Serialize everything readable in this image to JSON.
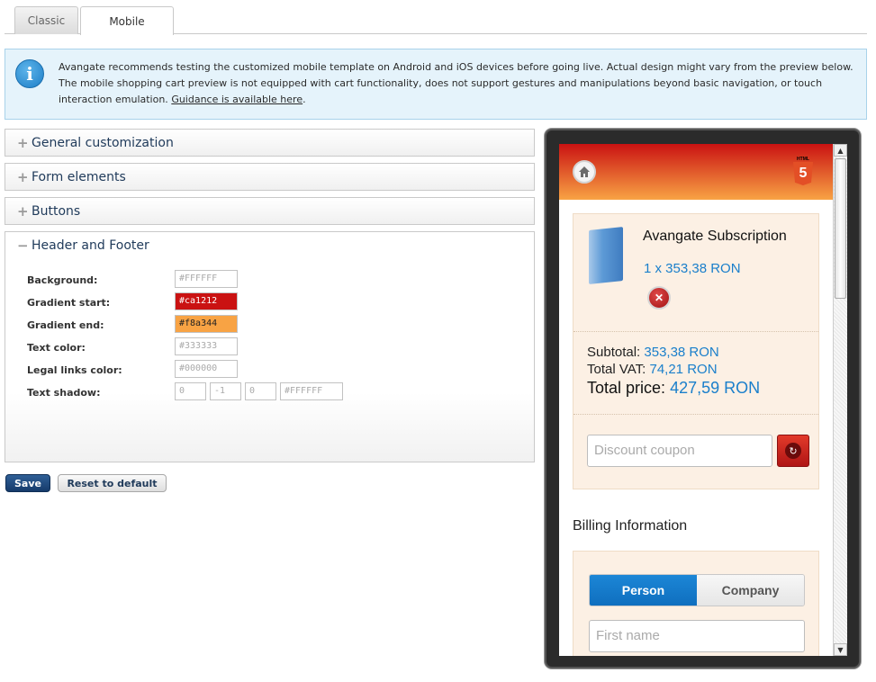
{
  "tabs": [
    {
      "label": "Classic"
    },
    {
      "label": "Mobile"
    }
  ],
  "info": {
    "icon": "info-icon",
    "text": "Avangate recommends testing the customized mobile template on Android and iOS devices before going live. Actual design might vary from the preview below. The mobile shopping cart preview is not equipped with cart functionality, does not support gestures and manipulations beyond basic navigation, or touch interaction emulation. ",
    "link": "Guidance is available here",
    "suffix": "."
  },
  "accordion": [
    {
      "sign": "+",
      "label": "General customization"
    },
    {
      "sign": "+",
      "label": "Form elements"
    },
    {
      "sign": "+",
      "label": "Buttons"
    },
    {
      "sign": "−",
      "label": "Header and Footer"
    }
  ],
  "header_footer": {
    "background": {
      "label": "Background:",
      "value": "#FFFFFF"
    },
    "gradient_start": {
      "label": "Gradient start:",
      "value": "#ca1212",
      "color": "#ca1212"
    },
    "gradient_end": {
      "label": "Gradient end:",
      "value": "#f8a344",
      "color": "#f8a344"
    },
    "text_color": {
      "label": "Text color:",
      "value": "#333333"
    },
    "legal_links_color": {
      "label": "Legal links color:",
      "value": "#000000"
    },
    "text_shadow": {
      "label": "Text shadow:",
      "x": "0",
      "y": "-1",
      "blur": "0",
      "color": "#FFFFFF"
    }
  },
  "actions": {
    "save": "Save",
    "reset": "Reset to default"
  },
  "preview": {
    "home_icon": "home-icon",
    "html5": {
      "caption": "HTML",
      "number": "5"
    },
    "product": {
      "name": "Avangate Subscription",
      "quantity_line": "1 x 353,38 RON"
    },
    "totals": {
      "subtotal_label": "Subtotal:",
      "subtotal_value": "353,38 RON",
      "vat_label": "Total VAT:",
      "vat_value": "74,21 RON",
      "total_label": "Total price:",
      "total_value": "427,59 RON"
    },
    "coupon_placeholder": "Discount coupon",
    "billing_title": "Billing Information",
    "person_label": "Person",
    "company_label": "Company",
    "first_name_placeholder": "First name"
  }
}
